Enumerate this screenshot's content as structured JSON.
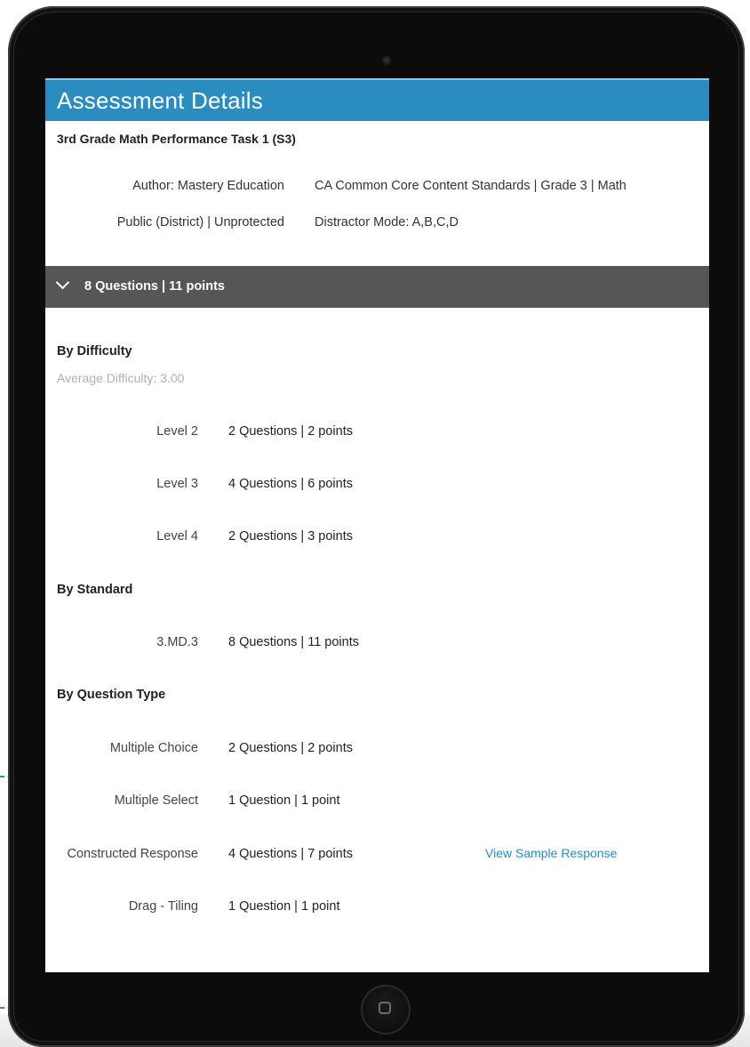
{
  "header": {
    "title": "Assessment Details"
  },
  "assessment": {
    "name": "3rd Grade Math Performance Task 1 (S3)",
    "author": "Author: Mastery Education",
    "standards_set": "CA Common Core Content Standards | Grade 3 | Math",
    "visibility": "Public (District) | Unprotected",
    "distractor_mode": "Distractor Mode: A,B,C,D"
  },
  "summary": {
    "text": "8 Questions | 11 points"
  },
  "by_difficulty": {
    "heading": "By Difficulty",
    "average": "Average Difficulty: 3.00",
    "rows": [
      {
        "label": "Level 2",
        "value": "2 Questions | 2 points"
      },
      {
        "label": "Level 3",
        "value": "4 Questions | 6 points"
      },
      {
        "label": "Level 4",
        "value": "2 Questions | 3 points"
      }
    ]
  },
  "by_standard": {
    "heading": "By Standard",
    "rows": [
      {
        "label": "3.MD.3",
        "value": "8 Questions | 11 points"
      }
    ]
  },
  "by_question_type": {
    "heading": "By Question Type",
    "rows": [
      {
        "label": "Multiple Choice",
        "value": "2 Questions | 2 points"
      },
      {
        "label": "Multiple Select",
        "value": "1 Question | 1 point"
      },
      {
        "label": "Constructed Response",
        "value": "4 Questions | 7 points"
      },
      {
        "label": "Drag - Tiling",
        "value": "1 Question | 1 point"
      }
    ],
    "sample_link": "View Sample Response"
  },
  "icons": {
    "expand": "chevron-down-icon",
    "camera": "camera-icon",
    "home": "home-button-icon"
  },
  "colors": {
    "header": "#2a8cbf",
    "summary_bar": "#565656",
    "link": "#2a8cbf",
    "muted_text": "#b0b0b0"
  }
}
